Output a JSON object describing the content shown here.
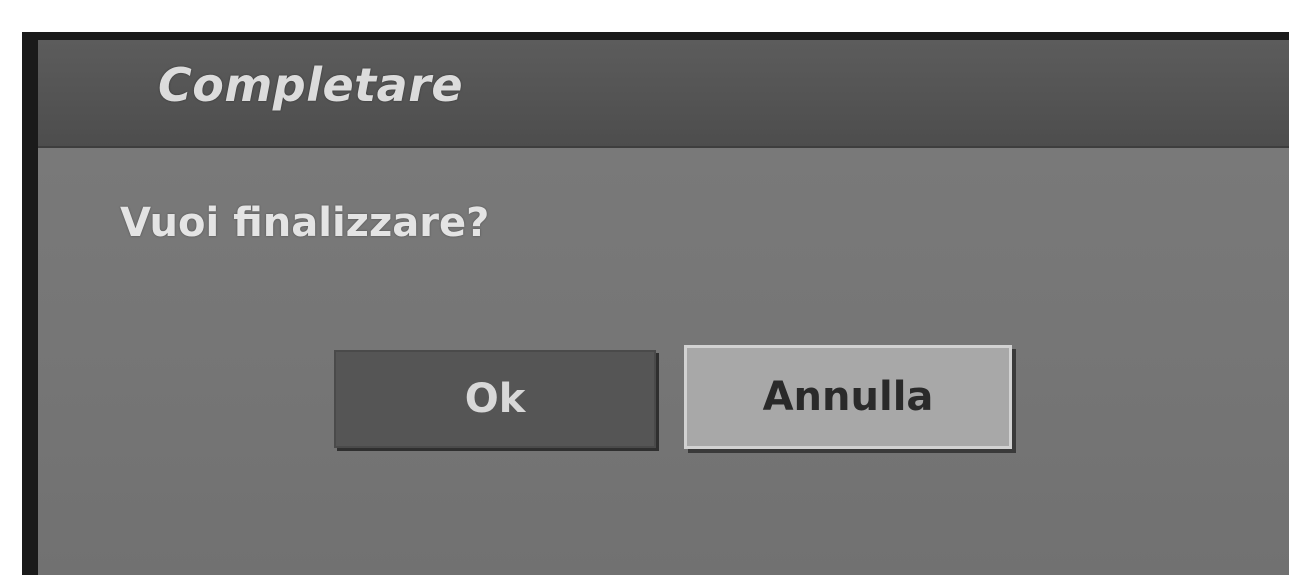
{
  "dialog": {
    "title": "Completare",
    "message": "Vuoi finalizzare?",
    "buttons": {
      "ok_label": "Ok",
      "cancel_label": "Annulla"
    }
  },
  "colors": {
    "title_bar": "#4d4d4d",
    "dialog_body": "#777777",
    "ok_button": "#555555",
    "cancel_button_selected": "#a8a8a8"
  }
}
